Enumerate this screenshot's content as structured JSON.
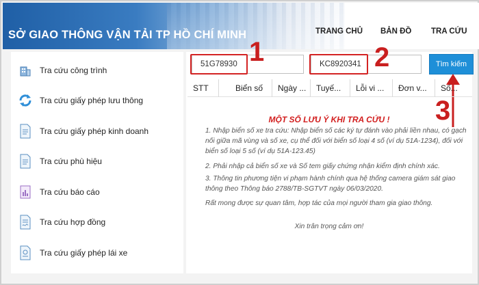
{
  "header": {
    "title": "SỞ GIAO THÔNG VẬN TẢI TP HỒ CHÍ MINH",
    "nav": [
      "TRANG CHỦ",
      "BẢN ĐỒ",
      "TRA CỨU"
    ]
  },
  "sidebar": {
    "items": [
      {
        "label": "Tra cứu công trình",
        "icon": "building-icon"
      },
      {
        "label": "Tra cứu giấy phép lưu thông",
        "icon": "refresh-icon"
      },
      {
        "label": "Tra cứu giấy phép kinh doanh",
        "icon": "document-icon"
      },
      {
        "label": "Tra cứu phù hiệu",
        "icon": "document-icon"
      },
      {
        "label": "Tra cứu báo cáo",
        "icon": "report-icon"
      },
      {
        "label": "Tra cứu hợp đồng",
        "icon": "contract-icon"
      },
      {
        "label": "Tra cứu giấy phép lái xe",
        "icon": "license-icon"
      }
    ]
  },
  "search": {
    "plate_value": "51G78930",
    "cert_value": "KC8920341",
    "button_label": "Tìm kiếm"
  },
  "annotations": {
    "n1": "1",
    "n2": "2",
    "n3": "3",
    "accent": "#c91f1f"
  },
  "table": {
    "columns": [
      "STT",
      "Biển số",
      "Ngày ...",
      "Tuyế...",
      "Lỗi vi ...",
      "Đơn v...",
      "Số..."
    ]
  },
  "notes": {
    "title": "MỘT SỐ LƯU Ý KHI TRA CỨU !",
    "lines": [
      "1. Nhập biển số xe tra cứu: Nhập biển số các ký tự đánh vào phải liền nhau, có gạch nối giữa mã vùng và số xe, cụ thể đối với biển số loại 4 số (ví dụ 51A-1234), đối với biển số loại 5 số (ví dụ 51A-123.45)",
      "2. Phải nhập cả biển số xe và Số tem giấy chứng nhận kiểm định chính xác.",
      "3. Thông tin phương tiện vi phạm hành chính qua hệ thống camera giám sát giao thông theo Thông báo 2788/TB-SGTVT ngày 06/03/2020.",
      "Rất mong được sự quan tâm, hợp tác của mọi người tham gia giao thông."
    ],
    "closing": "Xin trân trọng cảm ơn!"
  }
}
